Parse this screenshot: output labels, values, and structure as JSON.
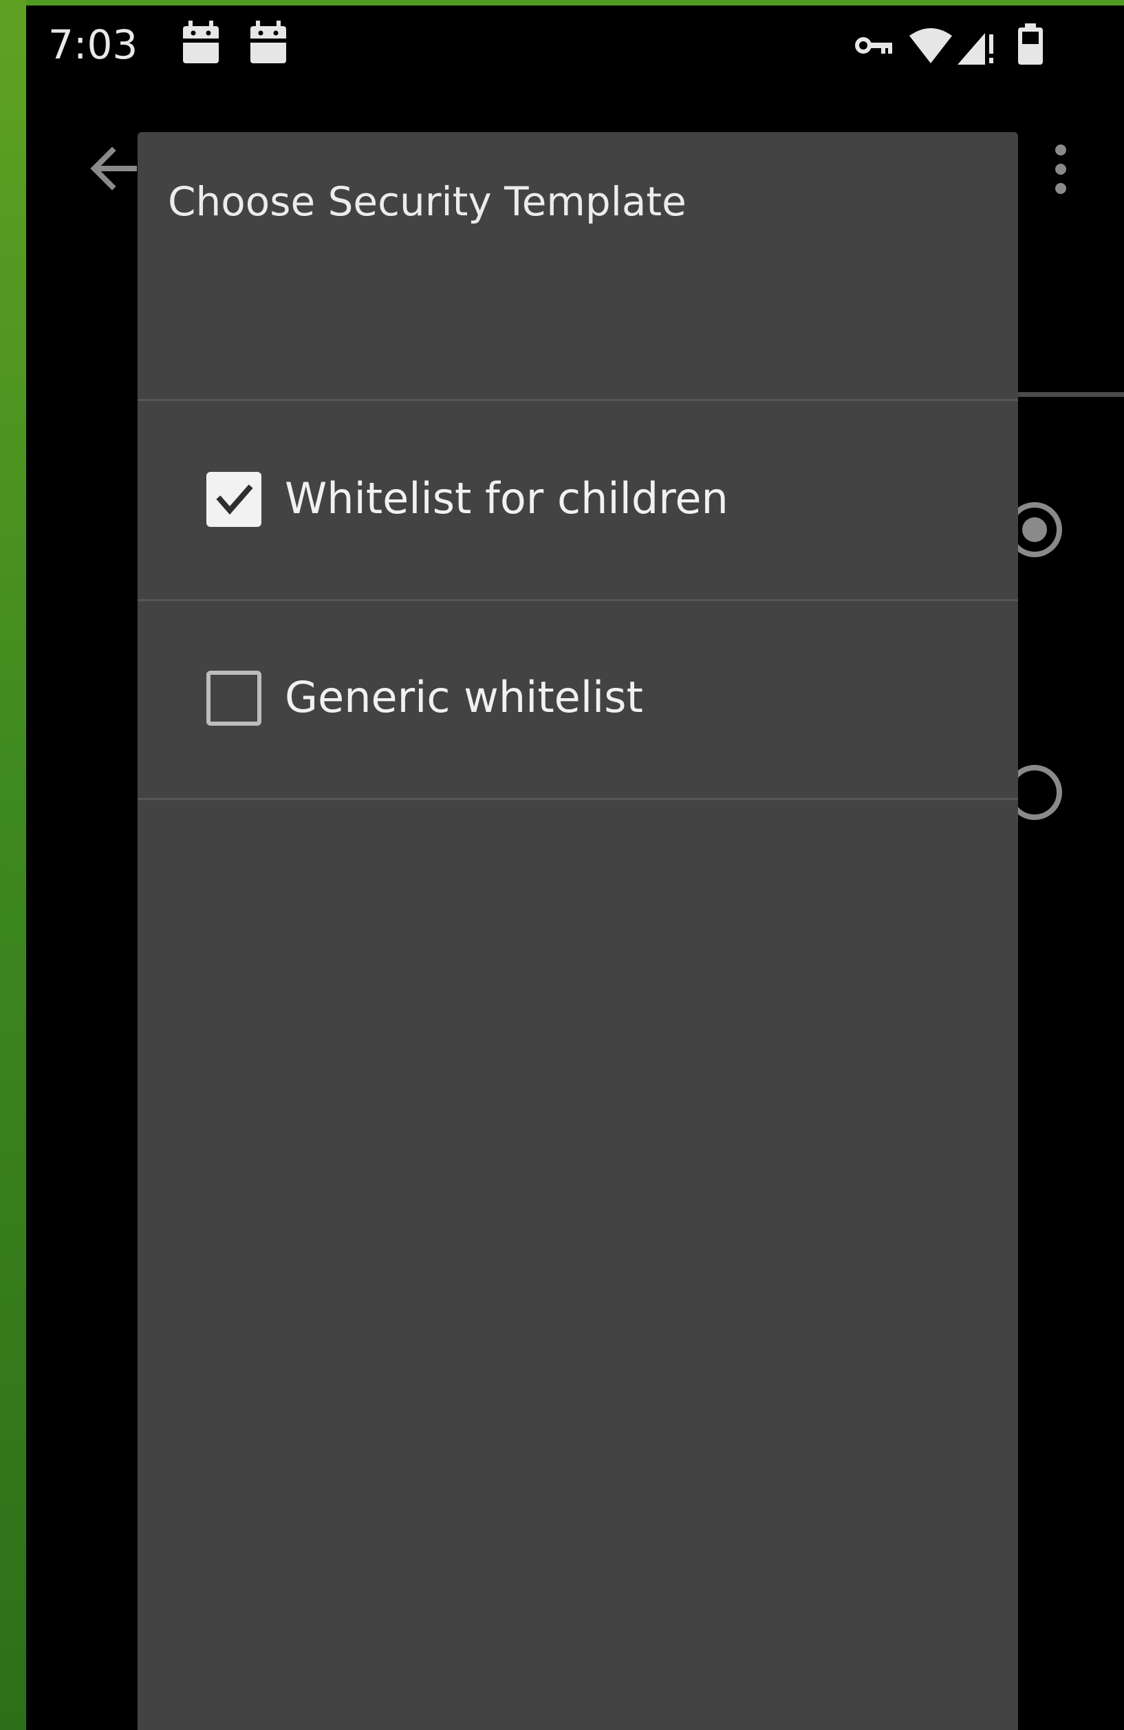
{
  "status_bar": {
    "time": "7:03",
    "notification_icons": [
      "android-debug-icon",
      "android-debug-icon"
    ],
    "system_icons": [
      "vpn-key-icon",
      "wifi-icon",
      "cell-signal-icon",
      "battery-icon"
    ]
  },
  "app_bar": {
    "back_icon": "arrow-left-icon",
    "overflow_icon": "more-vertical-icon"
  },
  "dialog": {
    "title": "Choose Security Template",
    "options": [
      {
        "label": "Whitelist for children",
        "checked": true
      },
      {
        "label": "Generic whitelist",
        "checked": false
      }
    ]
  },
  "background_radios": [
    {
      "selected": true
    },
    {
      "selected": false
    }
  ],
  "colors": {
    "dialog_bg": "#434343",
    "screen_bg": "#000000",
    "accent_green": "#4f9a22",
    "text": "#f1f1f1"
  }
}
